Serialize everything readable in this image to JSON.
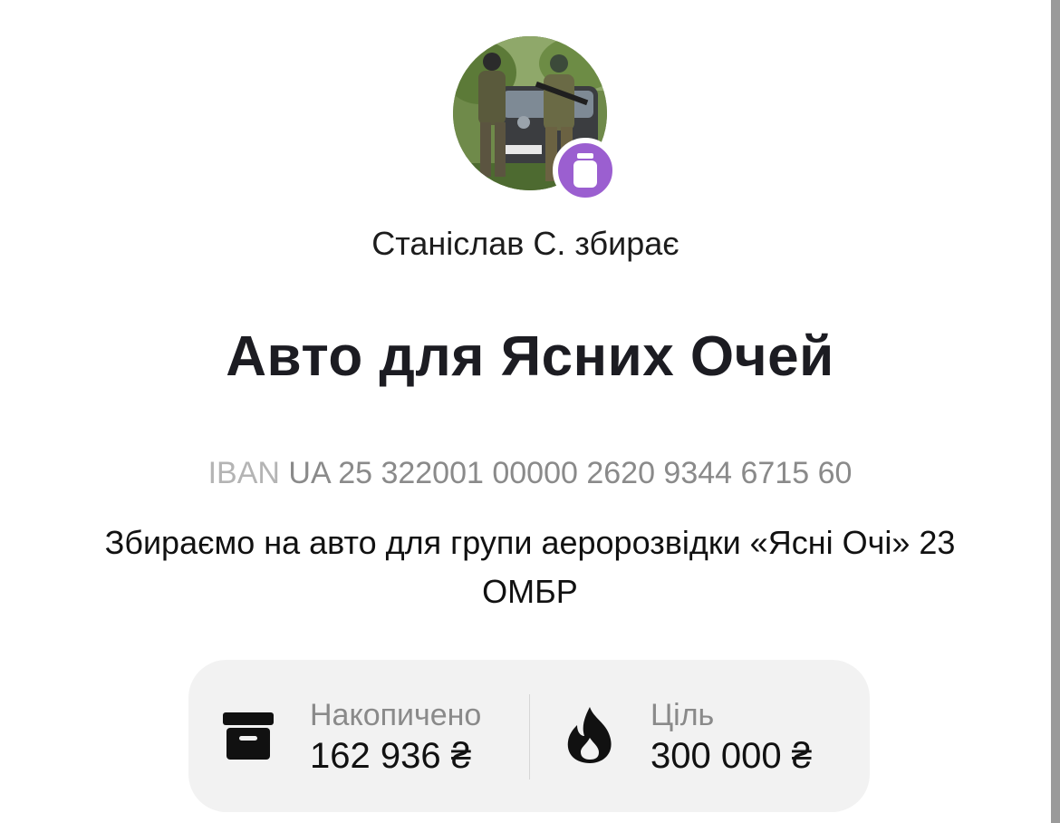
{
  "jar": {
    "collector_text": "Станіслав С. збирає",
    "title": "Авто для Ясних Очей",
    "iban_label": "IBAN",
    "iban_value": "UA 25 322001 00000 2620 9344 6715 60",
    "description": "Збираємо на авто для групи аеророзвідки «Ясні Очі» 23 ОМБР",
    "avatar_icon": "avatar-photo",
    "badge_icon": "jar-icon",
    "badge_color": "#9b5fd0"
  },
  "stats": {
    "accumulated": {
      "label": "Накопичено",
      "value": "162 936 ₴",
      "icon": "archive-box-icon"
    },
    "goal": {
      "label": "Ціль",
      "value": "300 000 ₴",
      "icon": "flame-icon"
    }
  }
}
